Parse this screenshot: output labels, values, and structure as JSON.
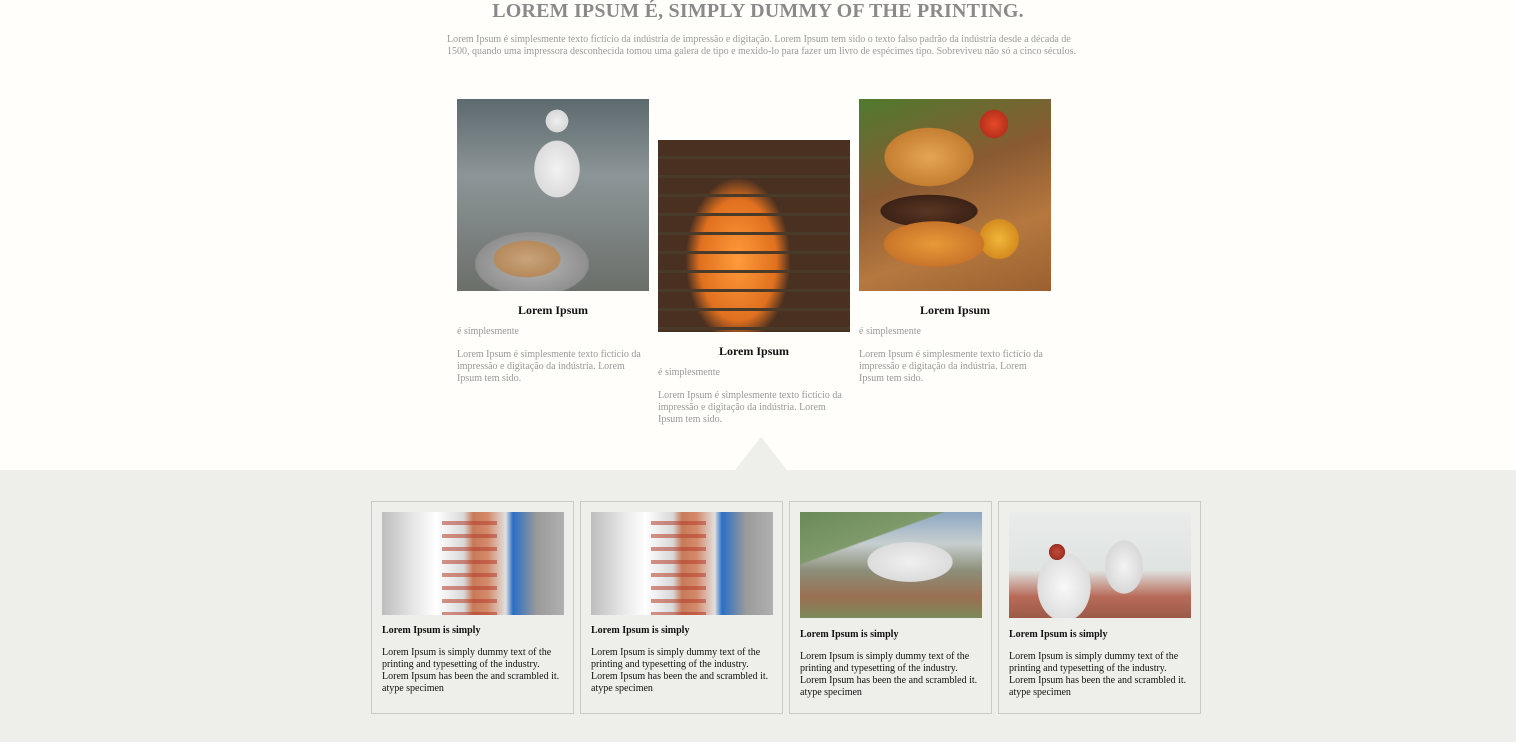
{
  "header": {
    "title": "LOREM IPSUM É, SIMPLY DUMMY OF THE PRINTING.",
    "intro": "Lorem Ipsum é simplesmente texto fictício da indústria de impressão e digitação. Lorem Ipsum tem sido o texto falso padrão da indústria desde a década de 1500, quando uma impressora desconhecida tomou uma galera de tipo e mexido-lo para fazer um livro de espécimes tipo. Sobreviveu não só a cinco séculos."
  },
  "features": [
    {
      "title": "Lorem Ipsum",
      "subtitle": "é simplesmente",
      "text": "Lorem Ipsum é simplesmente texto fictício da impressão e digitação da indústria. Lorem Ipsum tem sido.",
      "image": "lab-worker-cooking-photo"
    },
    {
      "title": "Lorem Ipsum",
      "subtitle": "é simplesmente",
      "text": "Lorem Ipsum é simplesmente texto fictício da impressão e digitação da indústria. Lorem Ipsum tem sido.",
      "image": "bread-oven-photo"
    },
    {
      "title": "Lorem Ipsum",
      "subtitle": "é simplesmente",
      "text": "Lorem Ipsum é simplesmente texto fictício da impressão e digitação da indústria. Lorem Ipsum tem sido.",
      "image": "burger-photo"
    }
  ],
  "cards": [
    {
      "title": "Lorem Ipsum is simply",
      "text": "Lorem Ipsum is simply dummy text of the printing and typesetting of the industry. Lorem Ipsum has been the and scrambled it. atype specimen",
      "image": "burger-conveyor-photo"
    },
    {
      "title": "Lorem Ipsum is simply",
      "text": "Lorem Ipsum is simply dummy text of the printing and typesetting of the industry. Lorem Ipsum has been the and scrambled it. atype specimen",
      "image": "burger-conveyor-photo"
    },
    {
      "title": "Lorem Ipsum is simply",
      "text": "Lorem Ipsum is simply dummy text of the printing and typesetting of the industry. Lorem Ipsum has been the and scrambled it. atype specimen",
      "image": "factory-aerial-photo"
    },
    {
      "title": "Lorem Ipsum is simply",
      "text": "Lorem Ipsum is simply dummy text of the printing and typesetting of the industry. Lorem Ipsum has been the and scrambled it. atype specimen",
      "image": "meat-processing-workers-photo"
    }
  ]
}
